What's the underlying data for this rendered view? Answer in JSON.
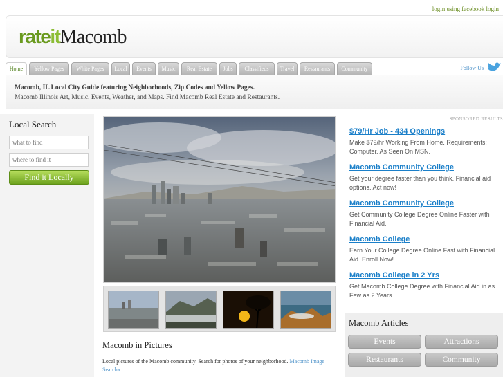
{
  "topbar": {
    "login_label": "login using facebook login"
  },
  "logo": {
    "part_rate": "rate",
    "part_it": "it",
    "part_city": "Macomb"
  },
  "nav": {
    "tabs": [
      {
        "label": "Home"
      },
      {
        "label": "Yellow Pages"
      },
      {
        "label": "White Pages"
      },
      {
        "label": "Local"
      },
      {
        "label": "Events"
      },
      {
        "label": "Music"
      },
      {
        "label": "Real Estate"
      },
      {
        "label": "Jobs"
      },
      {
        "label": "Classifieds"
      },
      {
        "label": "Travel"
      },
      {
        "label": "Restaurants"
      },
      {
        "label": "Community"
      }
    ],
    "follow_label": "Follow Us"
  },
  "description": {
    "line1": "Macomb, IL Local City Guide featuring Neighborhoods, Zip Codes and Yellow Pages.",
    "line2": "Macomb Illinois Art, Music, Events, Weather, and Maps. Find Macomb Real Estate and Restaurants."
  },
  "search": {
    "title": "Local Search",
    "what_placeholder": "what to find",
    "where_placeholder": "where to find it",
    "button_label": "Find it Locally"
  },
  "pictures": {
    "title": "Macomb in Pictures",
    "text": "Local pictures of the Macomb community. Search for photos of your neighborhood.",
    "link_label": "Macomb Image Search»"
  },
  "ads": {
    "sponsored_label": "SPONSORED RESULTS",
    "items": [
      {
        "title": "$79/Hr Job - 434 Openings",
        "text": "Make $79/hr Working From Home. Requirements: Computer. As Seen On MSN."
      },
      {
        "title": "Macomb Community College",
        "text": "Get your degree faster than you think. Financial aid options. Act now!"
      },
      {
        "title": "Macomb Community College",
        "text": "Get Community College Degree Online Faster with Financial Aid."
      },
      {
        "title": "Macomb College",
        "text": "Earn Your College Degree Online Fast with Financial Aid. Enroll Now!"
      },
      {
        "title": "Macomb College in 2 Yrs",
        "text": "Get Macomb College Degree with Financial Aid in as Few as 2 Years."
      }
    ]
  },
  "articles": {
    "title": "Macomb Articles",
    "buttons": [
      {
        "label": "Events"
      },
      {
        "label": "Attractions"
      },
      {
        "label": "Restaurants"
      },
      {
        "label": "Community"
      }
    ]
  },
  "colors": {
    "brand_green": "#6a9a1f",
    "link_blue": "#1a7fc9",
    "tab_gray": "#b5b5b5"
  }
}
